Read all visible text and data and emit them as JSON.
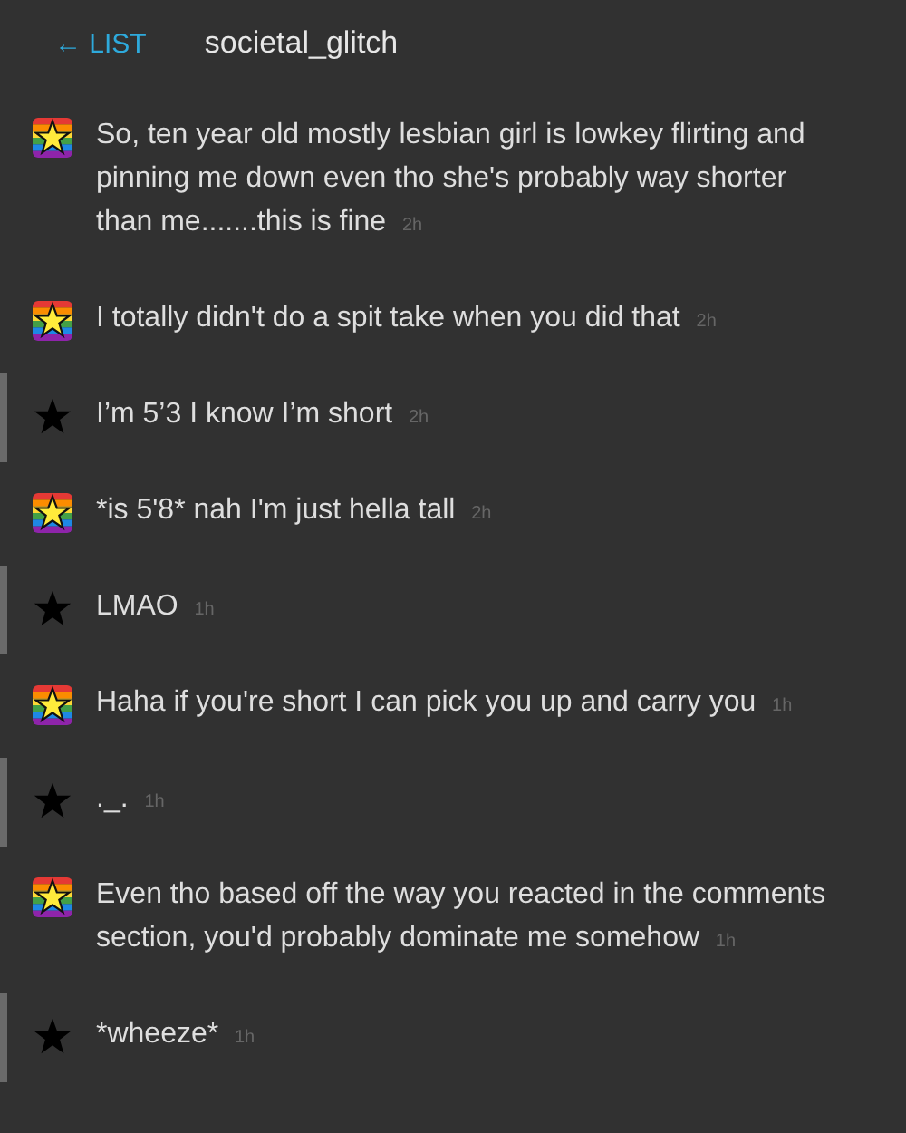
{
  "header": {
    "back_link": "← LIST",
    "title": "societal_glitch"
  },
  "messages": [
    {
      "kind": "rainbow",
      "text": "So, ten year old mostly lesbian girl is lowkey flirting and pinning me down even tho she's probably way shorter than me.......this is fine",
      "time": "2h"
    },
    {
      "kind": "rainbow",
      "text": "I totally didn't do a spit take when you did that",
      "time": "2h"
    },
    {
      "kind": "star",
      "text": "I’m 5’3 I know I’m short",
      "time": "2h"
    },
    {
      "kind": "rainbow",
      "text": "*is 5'8* nah I'm just hella tall",
      "time": "2h"
    },
    {
      "kind": "star",
      "text": "LMAO",
      "time": "1h"
    },
    {
      "kind": "rainbow",
      "text": "Haha if you're short I can pick you up and carry you",
      "time": "1h"
    },
    {
      "kind": "star",
      "text": "._.",
      "time": "1h"
    },
    {
      "kind": "rainbow",
      "text": "Even tho based off the way you reacted in the comments section, you'd probably dominate me somehow",
      "time": "1h"
    },
    {
      "kind": "star",
      "text": "*wheeze*",
      "time": "1h"
    }
  ]
}
